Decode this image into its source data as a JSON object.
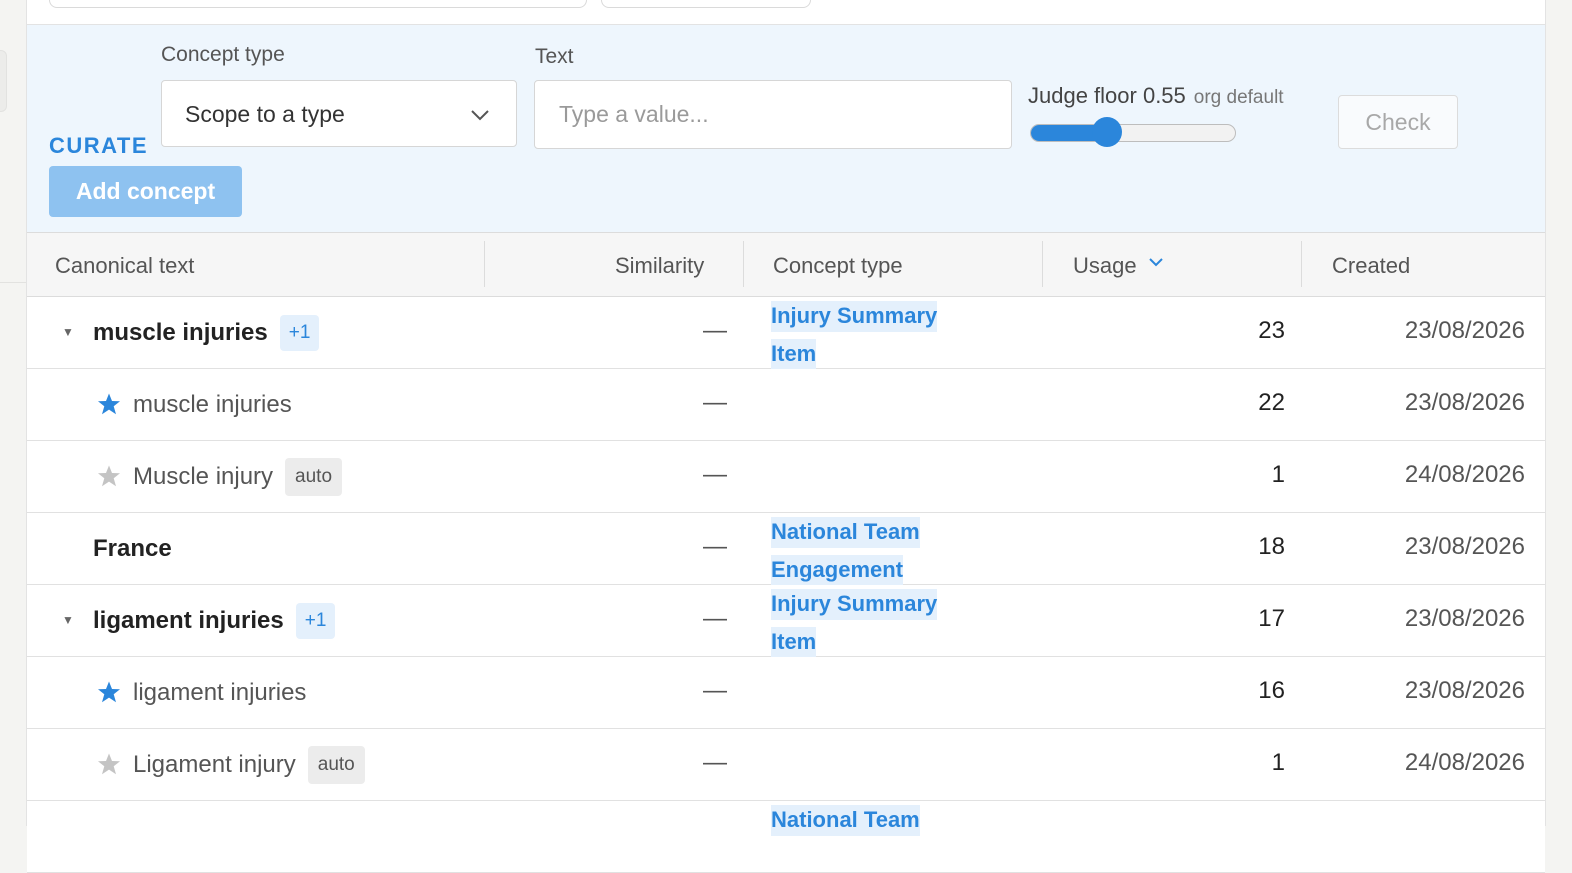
{
  "curate": {
    "section_label": "CURATE",
    "concept_type_label": "Concept type",
    "concept_type_value": "Scope to a type",
    "text_label": "Text",
    "text_placeholder": "Type a value...",
    "judge_floor_label": "Judge floor 0.55",
    "judge_floor_sub": "org default",
    "judge_floor_value": 0.55,
    "check_label": "Check",
    "add_label": "Add concept"
  },
  "table": {
    "headers": {
      "canonical": "Canonical text",
      "similarity": "Similarity",
      "concept_type": "Concept type",
      "usage": "Usage",
      "created": "Created"
    },
    "rows": [
      {
        "kind": "parent",
        "text": "muscle injuries",
        "badge": "+1",
        "similarity": "—",
        "type_line1": "Injury Summary",
        "type_line2": "Item",
        "usage": "23",
        "created": "23/08/2026"
      },
      {
        "kind": "child-canonical",
        "text": "muscle injuries",
        "similarity": "—",
        "usage": "22",
        "created": "23/08/2026"
      },
      {
        "kind": "child",
        "text": "Muscle injury",
        "badge": "auto",
        "similarity": "—",
        "usage": "1",
        "created": "24/08/2026"
      },
      {
        "kind": "single",
        "text": "France",
        "similarity": "—",
        "type_line1": "National Team",
        "type_line2": "Engagement",
        "usage": "18",
        "created": "23/08/2026"
      },
      {
        "kind": "parent",
        "text": "ligament injuries",
        "badge": "+1",
        "similarity": "—",
        "type_line1": "Injury Summary",
        "type_line2": "Item",
        "usage": "17",
        "created": "23/08/2026"
      },
      {
        "kind": "child-canonical",
        "text": "ligament injuries",
        "similarity": "—",
        "usage": "16",
        "created": "23/08/2026"
      },
      {
        "kind": "child",
        "text": "Ligament injury",
        "badge": "auto",
        "similarity": "—",
        "usage": "1",
        "created": "24/08/2026"
      },
      {
        "kind": "partial",
        "type_line1": "National Team"
      }
    ]
  },
  "colors": {
    "accent": "#2b86db",
    "curate_bg": "#eef6fd",
    "star_muted": "#c4c4c4"
  }
}
